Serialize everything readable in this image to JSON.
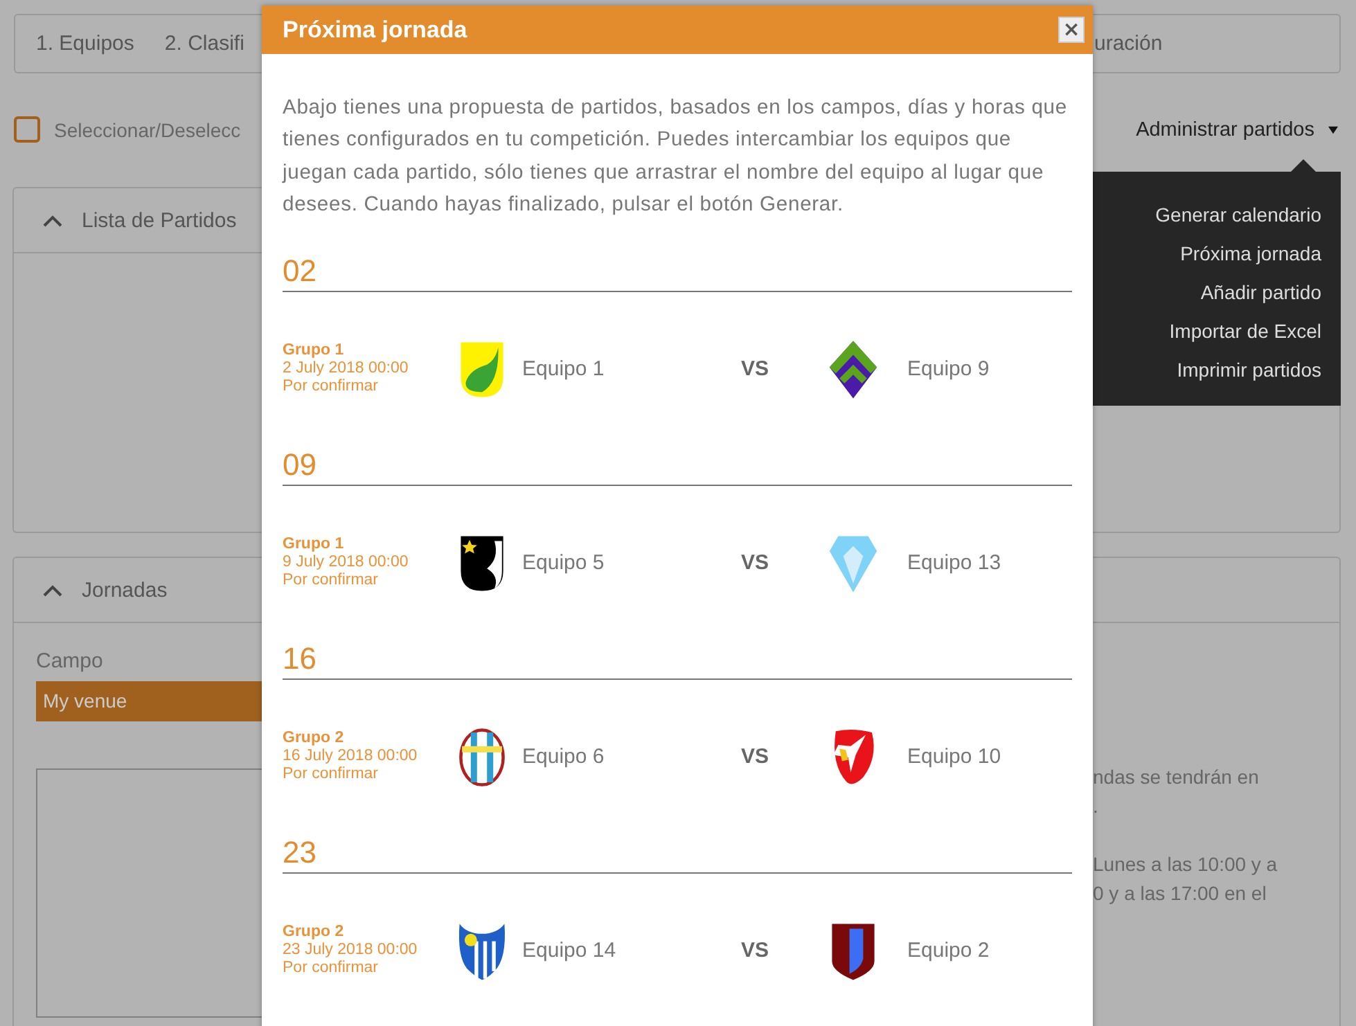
{
  "tabs": [
    {
      "label": "1. Equipos"
    },
    {
      "label": "2. Clasifi"
    },
    {
      "label": "uración"
    }
  ],
  "select_all": {
    "label": "Seleccionar/Deselecc",
    "checked": false
  },
  "manage_menu": {
    "label": "Administrar partidos",
    "expanded": true,
    "items": [
      "Generar calendario",
      "Próxima jornada",
      "Añadir partido",
      "Importar de Excel",
      "Imprimir partidos"
    ]
  },
  "panels": [
    {
      "title": "Lista de Partidos",
      "expanded": true
    },
    {
      "title": "Jornadas",
      "expanded": true
    }
  ],
  "venue_field": {
    "label": "Campo",
    "value": "My venue"
  },
  "right_text": [
    "ndas se tendrán en",
    ".",
    "Lunes a las 10:00 y a",
    "0 y a las 17:00 en el"
  ],
  "modal": {
    "title": "Próxima jornada",
    "close": "×",
    "description": "Abajo tienes una propuesta de partidos, basados en los campos, días y horas que tienes configurados en tu competición. Puedes intercambiar los equipos que juegan cada partido, sólo tienes que arrastrar el nombre del equipo al lugar que desees. Cuando hayas finalizado, pulsar el botón Generar.",
    "rounds": [
      {
        "date": "02",
        "match": {
          "group": "Grupo 1",
          "datetime": "2 July 2018 00:00",
          "status": "Por confirmar",
          "vs": "VS",
          "home": {
            "name": "Equipo 1",
            "kind": "leaf"
          },
          "away": {
            "name": "Equipo 9",
            "kind": "chevron"
          }
        }
      },
      {
        "date": "09",
        "match": {
          "group": "Grupo 1",
          "datetime": "9 July 2018 00:00",
          "status": "Por confirmar",
          "vs": "VS",
          "home": {
            "name": "Equipo 5",
            "kind": "star"
          },
          "away": {
            "name": "Equipo 13",
            "kind": "diamond"
          }
        }
      },
      {
        "date": "16",
        "match": {
          "group": "Grupo 2",
          "datetime": "16 July 2018 00:00",
          "status": "Por confirmar",
          "vs": "VS",
          "home": {
            "name": "Equipo 6",
            "kind": "stripes"
          },
          "away": {
            "name": "Equipo 10",
            "kind": "redstar"
          }
        }
      },
      {
        "date": "23",
        "match": {
          "group": "Grupo 2",
          "datetime": "23 July 2018 00:00",
          "status": "Por confirmar",
          "vs": "VS",
          "home": {
            "name": "Equipo 14",
            "kind": "bluebars"
          },
          "away": {
            "name": "Equipo 2",
            "kind": "shield"
          }
        }
      }
    ]
  }
}
